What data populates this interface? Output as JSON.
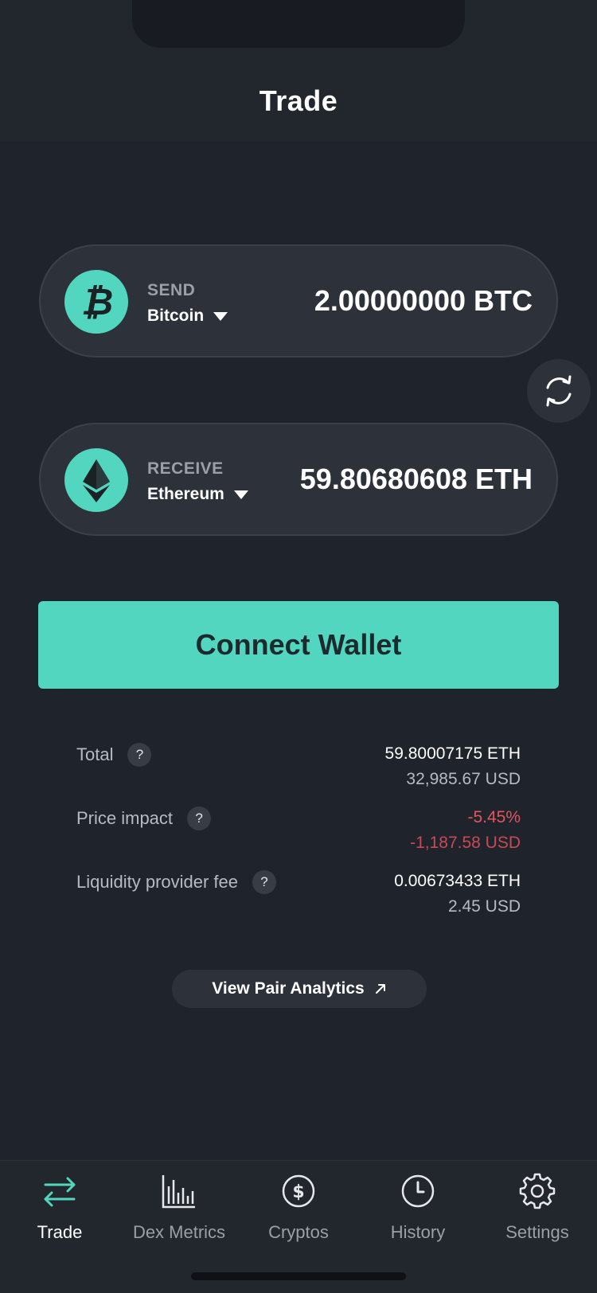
{
  "header": {
    "title": "Trade"
  },
  "send": {
    "label": "SEND",
    "asset": "Bitcoin",
    "amount": "2.00000000 BTC",
    "icon": "bitcoin-icon"
  },
  "receive": {
    "label": "RECEIVE",
    "asset": "Ethereum",
    "amount": "59.80680608 ETH",
    "icon": "ethereum-icon"
  },
  "swap": {
    "icon": "swap-arrows-icon"
  },
  "connect_label": "Connect Wallet",
  "stats": [
    {
      "label": "Total",
      "primary": "59.80007175 ETH",
      "secondary": "32,985.67 USD"
    },
    {
      "label": "Price impact",
      "primary": "-5.45%",
      "secondary": "-1,187.58 USD"
    },
    {
      "label": "Liquidity provider fee",
      "primary": "0.00673433 ETH",
      "secondary": "2.45 USD"
    }
  ],
  "help_mark": "?",
  "analytics_label": "View Pair Analytics",
  "tabs": [
    {
      "label": "Trade",
      "icon": "swap-icon",
      "active": true
    },
    {
      "label": "Dex Metrics",
      "icon": "bar-chart-icon"
    },
    {
      "label": "Cryptos",
      "icon": "dollar-icon"
    },
    {
      "label": "History",
      "icon": "clock-icon"
    },
    {
      "label": "Settings",
      "icon": "gear-icon"
    }
  ],
  "colors": {
    "accent": "#52d6c0",
    "negative": "#e25560",
    "background": "#1f232b",
    "card": "#2d3139"
  }
}
